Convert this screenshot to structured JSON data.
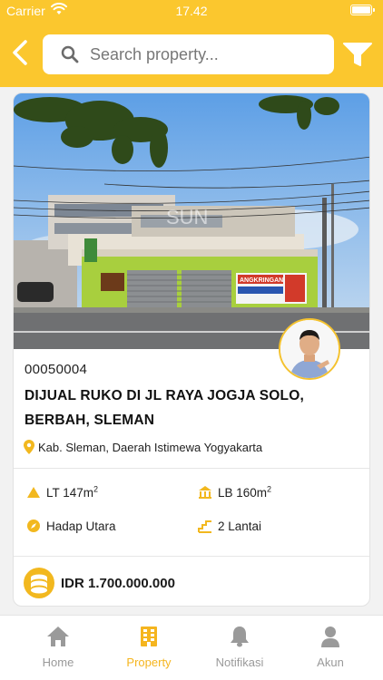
{
  "status_bar": {
    "carrier": "Carrier",
    "time": "17.42"
  },
  "search": {
    "placeholder": "Search property..."
  },
  "property": {
    "code": "00050004",
    "title": "DIJUAL RUKO DI JL RAYA JOGJA SOLO, BERBAH, SLEMAN",
    "location": "Kab. Sleman, Daerah Istimewa Yogyakarta",
    "land_area": "LT 147m",
    "building_area": "LB 160m",
    "area_unit_power": "2",
    "facing": "Hadap Utara",
    "floors": "2 Lantai",
    "price": "IDR 1.700.000.000",
    "photo_watermark": "SUN",
    "sign_text": "ANGKRINGAN PAK RAGIL"
  },
  "nav": {
    "items": [
      {
        "label": "Home",
        "icon": "home-icon",
        "active": false
      },
      {
        "label": "Property",
        "icon": "building-icon",
        "active": true
      },
      {
        "label": "Notifikasi",
        "icon": "bell-icon",
        "active": false
      },
      {
        "label": "Akun",
        "icon": "user-icon",
        "active": false
      }
    ]
  },
  "colors": {
    "accent": "#fbc72e",
    "active_nav": "#f5b51f",
    "inactive_nav": "#9a9a9a"
  }
}
